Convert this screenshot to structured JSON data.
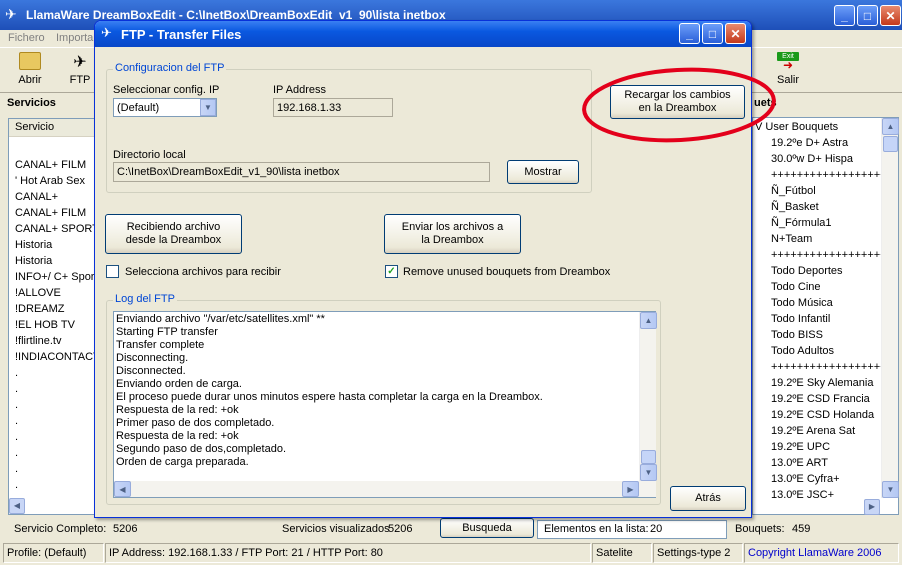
{
  "main_window": {
    "title": "LlamaWare DreamBoxEdit - C:\\InetBox\\DreamBoxEdit_v1_90\\lista inetbox",
    "menu": [
      "Fichero",
      "Importa"
    ],
    "toolbar": {
      "open_label": "Abrir",
      "ftp_label": "FTP",
      "exit_label": "Salir",
      "exit_badge": "Exit"
    }
  },
  "services_panel": {
    "title": "Servicios",
    "column_header": "Servicio",
    "items": [
      "",
      "CANAL+ FILM",
      "' Hot Arab Sex",
      "CANAL+",
      "CANAL+ FILM",
      "CANAL+ SPORT",
      "Historia",
      "Historia",
      "INFO+/ C+ Sport",
      "!ALLOVE",
      "!DREAMZ",
      "!EL HOB TV",
      "!flirtline.tv",
      "!INDIACONTACT",
      ".",
      ".",
      ".",
      ".",
      ".",
      ".",
      ".",
      ".",
      "."
    ]
  },
  "bouquets_panel": {
    "title": "uets",
    "items": [
      "V User Bouquets",
      "19.2ºe D+ Astra",
      "30.0ºw D+ Hispa",
      "+++++++++++++++++++++",
      "Ñ_Fútbol",
      "Ñ_Basket",
      "Ñ_Fórmula1",
      "N+Team",
      "+++++++++++++++++++++",
      "Todo Deportes",
      "Todo Cine",
      "Todo Música",
      "Todo Infantil",
      "Todo BISS",
      "Todo Adultos",
      "+++++++++++++++++++++",
      "19.2ºE Sky Alemania",
      "19.2ºE CSD Francia",
      "19.2ºE CSD Holanda",
      "19.2ºE Arena Sat",
      "19.2ºE UPC",
      "13.0ºE ART",
      "13.0ºE Cyfra+",
      "13.0ºE JSC+"
    ]
  },
  "counts_bar": {
    "servicio_completo_label": "Servicio Completo:",
    "servicio_completo_value": "5206",
    "visualizados_label": "Servicios visualizados",
    "visualizados_value": "5206",
    "busqueda_label": "Busqueda",
    "elementos_label": "Elementos en la lista:",
    "elementos_value": "20",
    "bouquets_label": "Bouquets:",
    "bouquets_value": "459"
  },
  "status_bar": {
    "profile": "Profile: (Default)",
    "connection": "IP Address: 192.168.1.33 / FTP Port: 21 / HTTP Port: 80",
    "satellite": "Satelite",
    "settings": "Settings-type 2",
    "copyright": "Copyright LlamaWare 2006"
  },
  "ftp_dialog": {
    "title": "FTP - Transfer Files",
    "config_group": "Configuracion del FTP",
    "select_config_label": "Seleccionar config. IP",
    "select_config_value": "(Default)",
    "ip_label": "IP Address",
    "ip_value": "192.168.1.33",
    "local_dir_label": "Directorio local",
    "local_dir_value": "C:\\InetBox\\DreamBoxEdit_v1_90\\lista inetbox",
    "show_button": "Mostrar",
    "reload_button": "Recargar los cambios en la Dreambox",
    "receive_button": "Recibiendo archivo desde la Dreambox",
    "send_button": "Enviar los archivos a la Dreambox",
    "select_files_checkbox": "Selecciona archivos para recibir",
    "remove_unused_checkbox": "Remove unused bouquets from Dreambox",
    "log_group": "Log del FTP",
    "log_lines": [
      "Enviando archivo \"/var/etc/satellites.xml\" **",
      "Starting FTP transfer",
      "Transfer complete",
      "Disconnecting.",
      "Disconnected.",
      "Enviando orden de carga.",
      "El proceso puede durar unos minutos espere hasta completar la carga en la Dreambox.",
      "Respuesta de la red: +ok",
      "Primer paso de dos completado.",
      "Respuesta de la red: +ok",
      "Segundo paso de dos,completado.",
      "Orden de carga preparada."
    ],
    "back_button": "Atrás"
  },
  "colors": {
    "title_blue": "#0a246a",
    "annotation_red": "#e3001b",
    "link_blue": "#0000cc"
  }
}
